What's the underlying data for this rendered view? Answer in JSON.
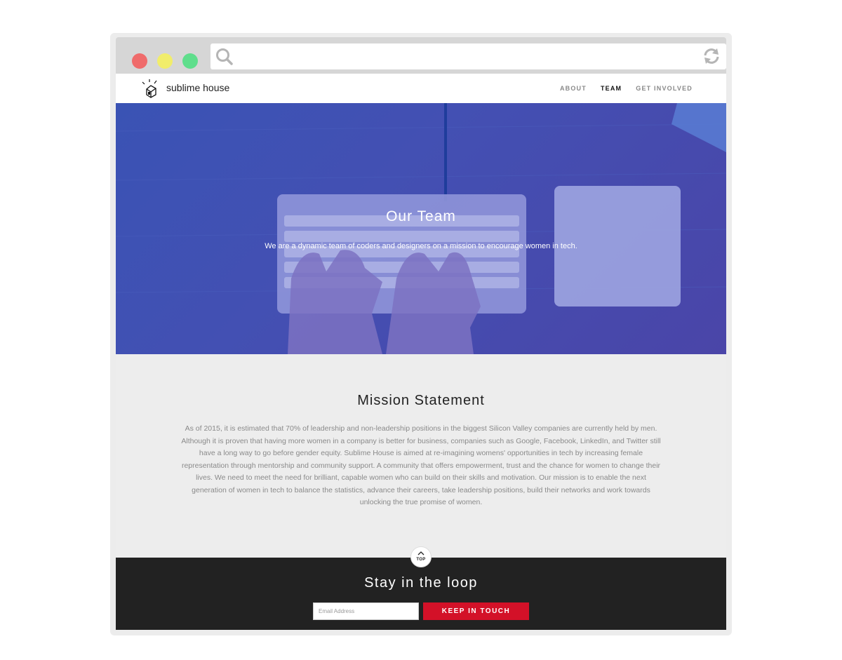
{
  "browser": {
    "dots": [
      {
        "name": "close-dot",
        "color": "#ef6b6b"
      },
      {
        "name": "minimize-dot",
        "color": "#f1ed6b"
      },
      {
        "name": "maximize-dot",
        "color": "#5fde8c"
      }
    ],
    "icons": {
      "search": "search-icon",
      "reload": "reload-icon"
    }
  },
  "nav": {
    "brand": "sublime house",
    "links": [
      "ABOUT",
      "TEAM",
      "GET INVOLVED"
    ],
    "active_link": "TEAM"
  },
  "hero": {
    "title": "Our Team",
    "subtitle": "We are a dynamic team of coders and designers on a mission to encourage women in tech."
  },
  "mission": {
    "title": "Mission Statement",
    "body": "As of 2015, it is estimated that 70% of leadership and non-leadership positions in the biggest Silicon Valley companies are currently held by men. Although it is proven that having more women in a company is better for business, companies such as Google, Facebook, LinkedIn, and Twitter still have a long way to go before gender equity. Sublime House is aimed at re-imagining womens' opportunities in tech by increasing female representation through mentorship and community support. A community that offers empowerment, trust and the chance for women to change their lives. We need to meet the need for brilliant, capable women who can build on their skills and motivation. Our mission is to enable the next generation of women in tech to balance the statistics, advance their careers, take leadership positions, build their networks and work towards unlocking the true promise of women."
  },
  "top_button": {
    "label": "TOP"
  },
  "footer": {
    "title": "Stay in the loop",
    "email_placeholder": "Email Address",
    "email_value": "",
    "button_label": "KEEP IN TOUCH"
  },
  "colors": {
    "accent_red": "#d31128",
    "hero_blue": "#4350b3",
    "footer_bg": "#222222",
    "page_bg": "#ededed"
  }
}
